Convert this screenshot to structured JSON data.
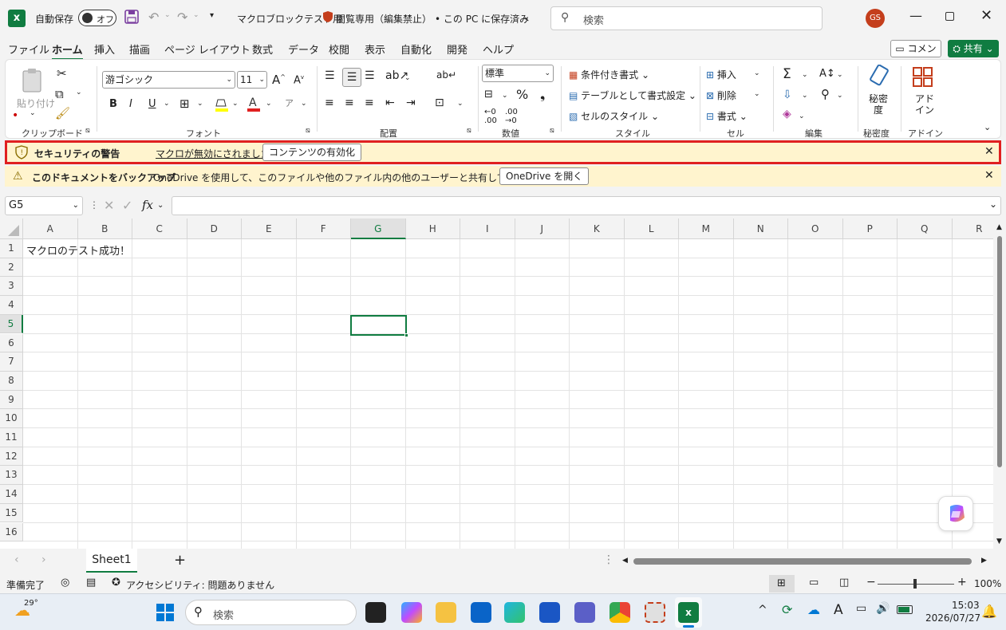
{
  "titlebar": {
    "autosave_label": "自動保存",
    "autosave_state": "オフ",
    "filename": "マクロブロックテスト用",
    "readonly": "閲覧専用（編集禁止）",
    "save_location": "• この PC に保存済み",
    "search_placeholder": "検索",
    "avatar": "GS"
  },
  "menu": {
    "items": [
      "ファイル",
      "ホーム",
      "挿入",
      "描画",
      "ページ レイアウト",
      "数式",
      "データ",
      "校閲",
      "表示",
      "自動化",
      "開発",
      "ヘルプ"
    ],
    "comment": "コメント",
    "share": "共有"
  },
  "ribbon": {
    "paste": "貼り付け",
    "clipboard": "クリップボード",
    "font_name": "游ゴシック",
    "font_size": "11",
    "font_group": "フォント",
    "bold": "B",
    "italic": "I",
    "underline": "U",
    "align_group": "配置",
    "number_format": "標準",
    "number_group": "数値",
    "cond_format": "条件付き書式",
    "table_format": "テーブルとして書式設定",
    "cell_style": "セルのスタイル",
    "style_group": "スタイル",
    "insert": "挿入",
    "delete": "削除",
    "format": "書式",
    "cell_group": "セル",
    "edit_group": "編集",
    "sensitivity": "秘密\n度",
    "sensitivity_top": "秘密",
    "sensitivity_bottom": "度",
    "sensitivity_group": "秘密度",
    "addin_top": "アド",
    "addin_bottom": "イン",
    "addin_group": "アドイン"
  },
  "security_bar": {
    "title": "セキュリティの警告",
    "message": "マクロが無効にされました。",
    "button": "コンテンツの有効化"
  },
  "backup_bar": {
    "title": "このドキュメントをバックアップ",
    "message": "OneDrive を使用して、このファイルや他のファイル内の他のユーザーと共有して作業します。",
    "button": "OneDrive を開く"
  },
  "formula": {
    "namebox": "G5",
    "fx": "fx",
    "value": ""
  },
  "grid": {
    "columns": [
      "A",
      "B",
      "C",
      "D",
      "E",
      "F",
      "G",
      "H",
      "I",
      "J",
      "K",
      "L",
      "M",
      "N",
      "O",
      "P",
      "Q",
      "R"
    ],
    "rows": [
      "1",
      "2",
      "3",
      "4",
      "5",
      "6",
      "7",
      "8",
      "9",
      "10",
      "11",
      "12",
      "13",
      "14",
      "15",
      "16"
    ],
    "a1": "マクロのテスト成功！"
  },
  "sheets": {
    "tab": "Sheet1",
    "add": "+"
  },
  "status": {
    "ready": "準備完了",
    "accessibility": "アクセシビリティ: 問題ありません",
    "zoom": "100%"
  },
  "taskbar": {
    "temp": "29°",
    "search": "検索",
    "time": "15:03",
    "date": "2026/07/27"
  }
}
